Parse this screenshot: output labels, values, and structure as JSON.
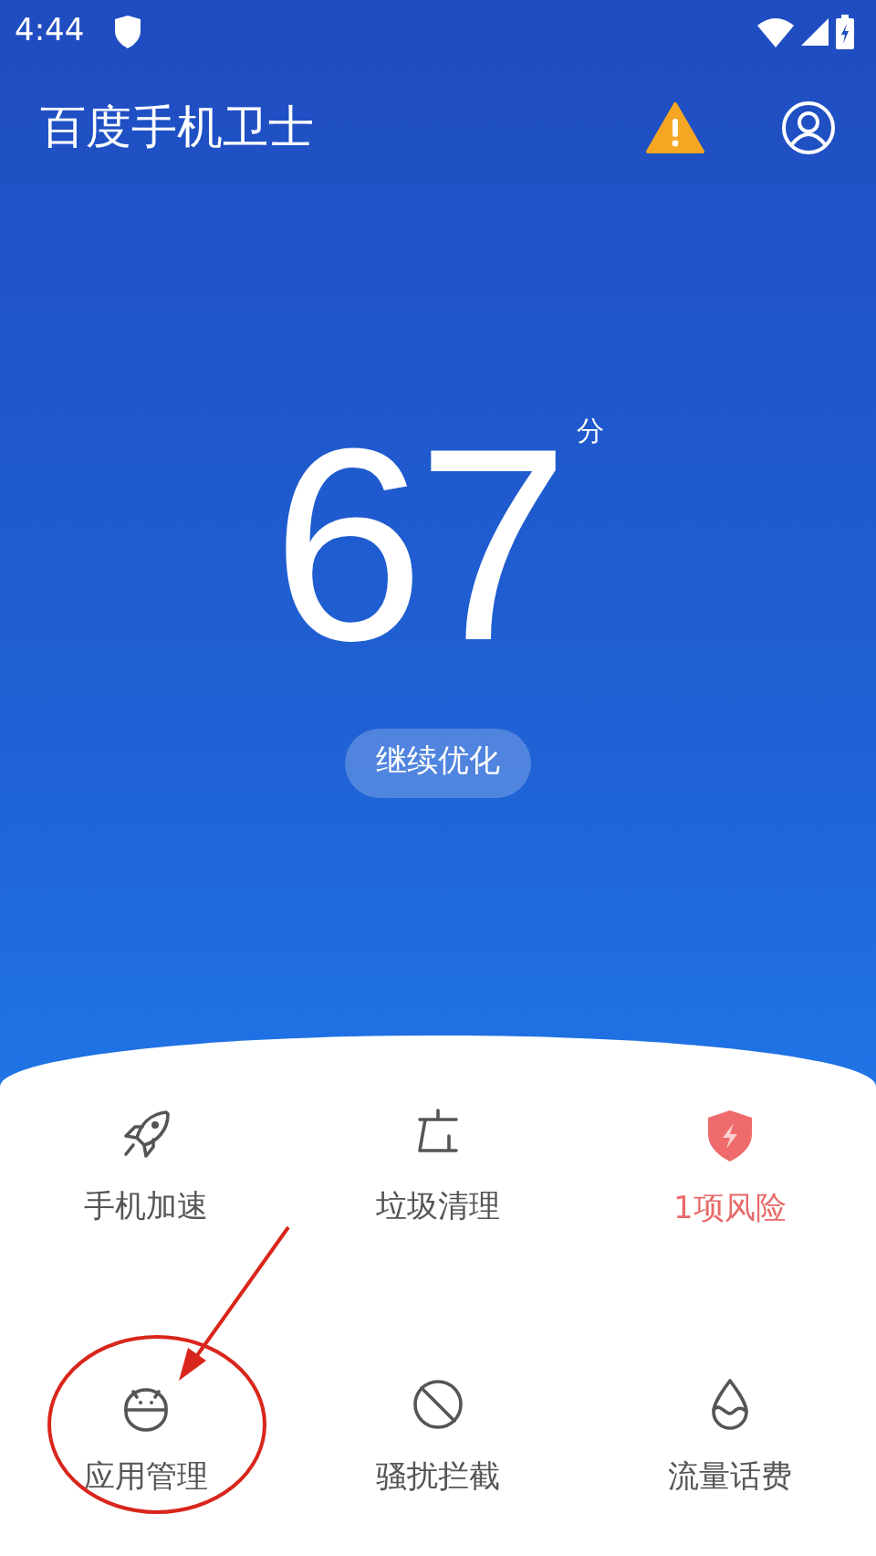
{
  "status_bar": {
    "time": "4:44"
  },
  "header": {
    "title": "百度手机卫士"
  },
  "score": {
    "value": "67",
    "unit": "分",
    "button": "继续优化"
  },
  "tools": [
    {
      "kind": "rocket",
      "label": "手机加速",
      "alert": false
    },
    {
      "kind": "broom",
      "label": "垃圾清理",
      "alert": false
    },
    {
      "kind": "shield",
      "label": "1项风险",
      "alert": true
    },
    {
      "kind": "android",
      "label": "应用管理",
      "alert": false
    },
    {
      "kind": "block",
      "label": "骚扰拦截",
      "alert": false
    },
    {
      "kind": "drop",
      "label": "流量话费",
      "alert": false
    }
  ]
}
